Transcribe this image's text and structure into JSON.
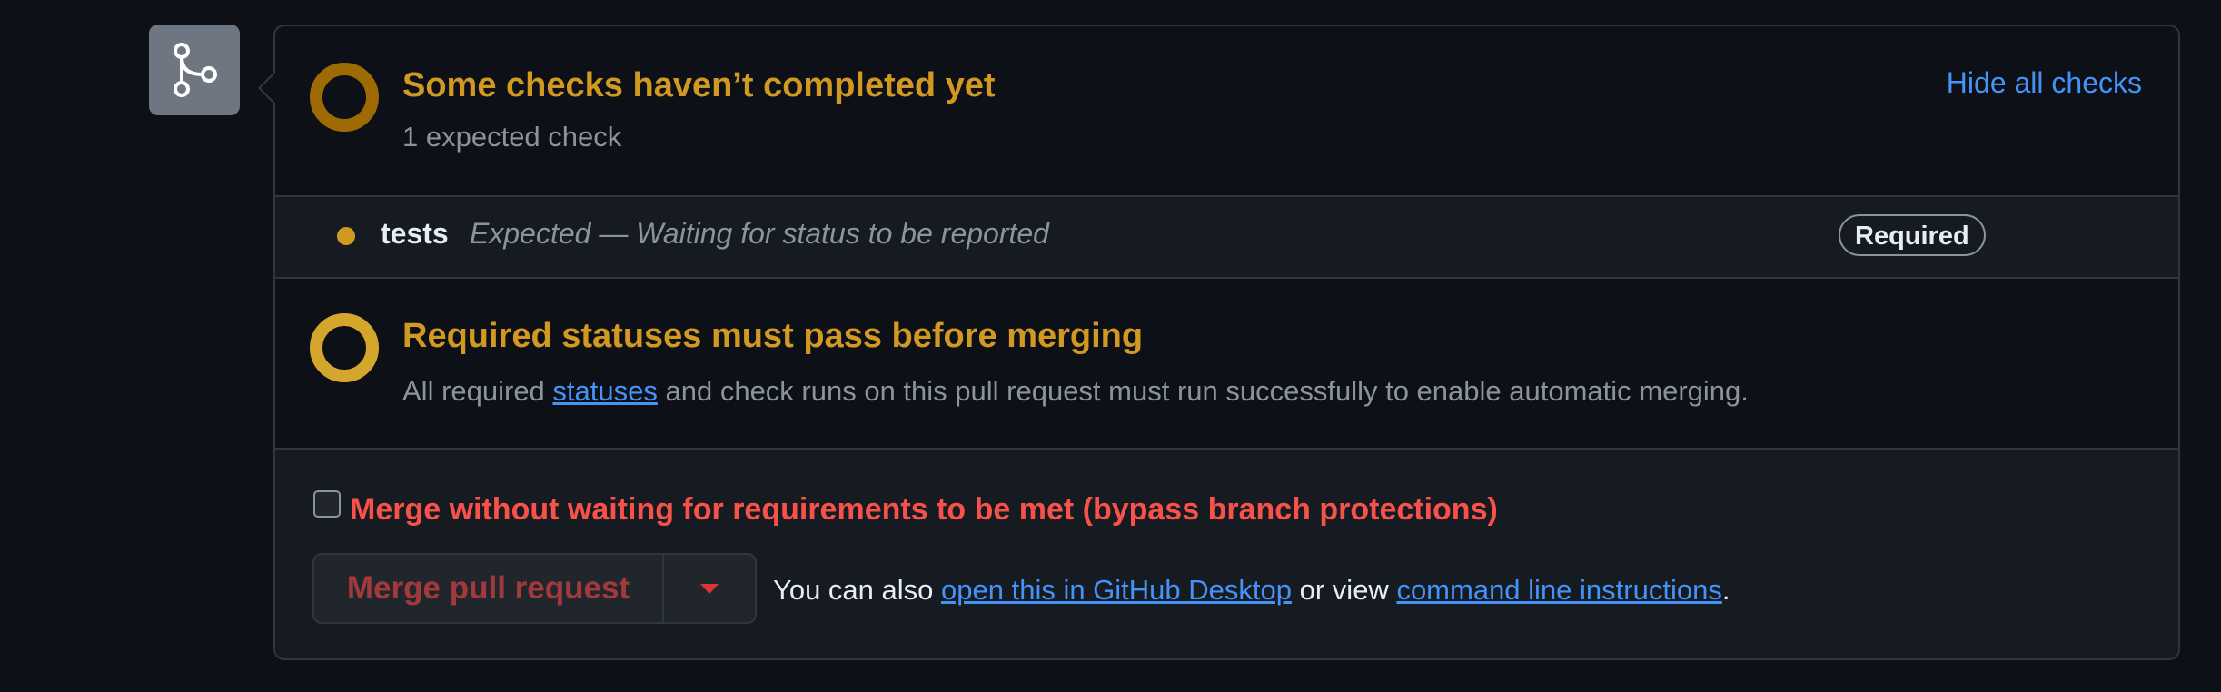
{
  "icons": {
    "merge": "git-merge-icon",
    "dropdown": "triangle-down-icon"
  },
  "colors": {
    "pending": "#9e6a03",
    "required": "#d4a72c",
    "warning_text": "#d29922",
    "danger": "#f85149",
    "link": "#4493f8"
  },
  "checks_section": {
    "title": "Some checks haven’t completed yet",
    "subtitle": "1 expected check",
    "hide_link": "Hide all checks"
  },
  "checks": [
    {
      "name": "tests",
      "description": "Expected — Waiting for status to be reported",
      "badge": "Required"
    }
  ],
  "required_section": {
    "title": "Required statuses must pass before merging",
    "desc_before": "All required ",
    "desc_link": "statuses",
    "desc_after": " and check runs on this pull request must run successfully to enable automatic merging."
  },
  "merge_section": {
    "bypass_label": "Merge without waiting for requirements to be met (bypass branch protections)",
    "bypass_checked": false,
    "merge_button": "Merge pull request",
    "also_prefix": "You can also ",
    "desktop_link": "open this in GitHub Desktop",
    "also_middle": " or view ",
    "cli_link": "command line instructions",
    "also_suffix": "."
  }
}
